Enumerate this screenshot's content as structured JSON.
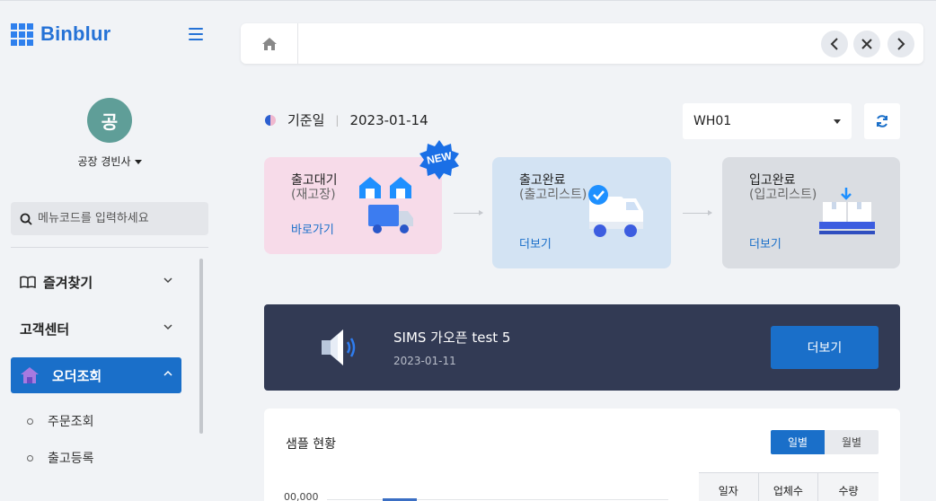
{
  "brand": {
    "logo_text": "Binblur",
    "accent": "#1a6fc9"
  },
  "user": {
    "avatar_initial": "공",
    "name": "공장 경빈사"
  },
  "sidebar": {
    "search_placeholder": "메뉴코드를 입력하세요",
    "menu": [
      {
        "label": "즐겨찾기",
        "icon": "book-icon",
        "expanded": false
      },
      {
        "label": "고객센터",
        "expanded": false
      },
      {
        "label": "오더조회",
        "icon": "home-icon",
        "expanded": true,
        "active": true
      }
    ],
    "submenu": [
      "주문조회",
      "출고등록"
    ]
  },
  "topbar": {
    "home_icon": "home-icon",
    "prev_icon": "chevron-left-icon",
    "close_icon": "close-icon",
    "next_icon": "chevron-right-icon"
  },
  "base_date": {
    "label": "기준일",
    "value": "2023-01-14"
  },
  "warehouse": {
    "selected": "WH01"
  },
  "cards": [
    {
      "title": "출고대기",
      "subtitle": "(재고장)",
      "link": "바로가기",
      "badge": "NEW",
      "color": "#f7dbe9"
    },
    {
      "title": "출고완료",
      "subtitle": "(출고리스트)",
      "link": "더보기",
      "color": "#d3e3f3"
    },
    {
      "title": "입고완료",
      "subtitle": "(입고리스트)",
      "link": "더보기",
      "color": "#dadde2"
    }
  ],
  "notice": {
    "title": "SIMS 가오픈 test 5",
    "date": "2023-01-11",
    "button": "더보기"
  },
  "sample": {
    "title": "샘플 현황",
    "toggle_daily": "일별",
    "toggle_monthly": "월별",
    "y_tick": "00,000",
    "table_headers": [
      "일자",
      "업체수",
      "수량"
    ]
  }
}
